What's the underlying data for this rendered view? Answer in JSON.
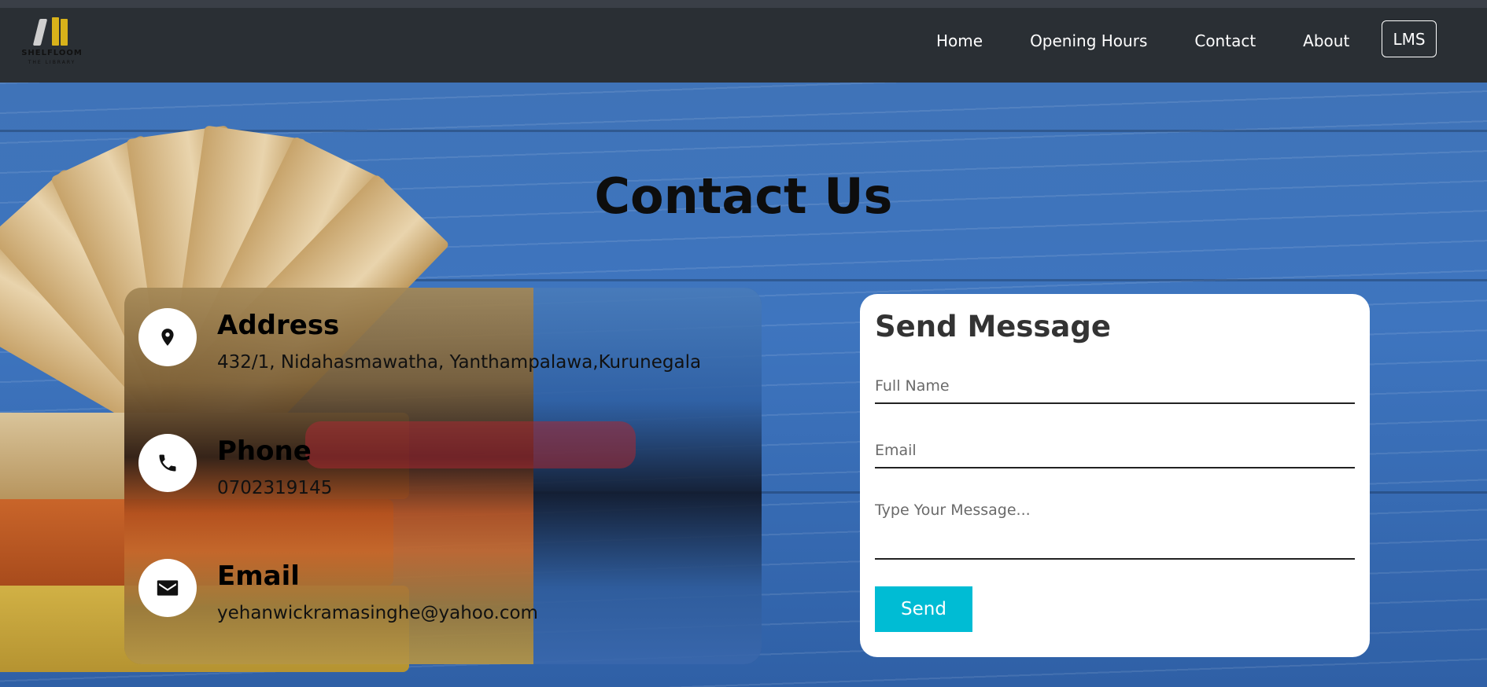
{
  "navbar": {
    "logo_text": "SHELFLOOM",
    "logo_sub": "THE LIBRARY",
    "links": [
      {
        "label": "Home"
      },
      {
        "label": "Opening Hours"
      },
      {
        "label": "Contact"
      },
      {
        "label": "About"
      }
    ],
    "lms_label": "LMS"
  },
  "page": {
    "title": "Contact Us"
  },
  "contact_info": {
    "address": {
      "heading": "Address",
      "value": "432/1, Nidahasmawatha, Yanthampalawa,Kurunegala",
      "icon": "map-pin-icon"
    },
    "phone": {
      "heading": "Phone",
      "value": "0702319145",
      "icon": "phone-icon"
    },
    "email": {
      "heading": "Email",
      "value": "yehanwickramasinghe@yahoo.com",
      "icon": "envelope-icon"
    }
  },
  "form": {
    "title": "Send Message",
    "full_name_placeholder": "Full Name",
    "email_placeholder": "Email",
    "message_placeholder": "Type Your Message...",
    "send_label": "Send"
  },
  "colors": {
    "navbar_bg": "#2a2f34",
    "send_button": "#00bcd4",
    "hero_blue": "#3e75bf"
  }
}
